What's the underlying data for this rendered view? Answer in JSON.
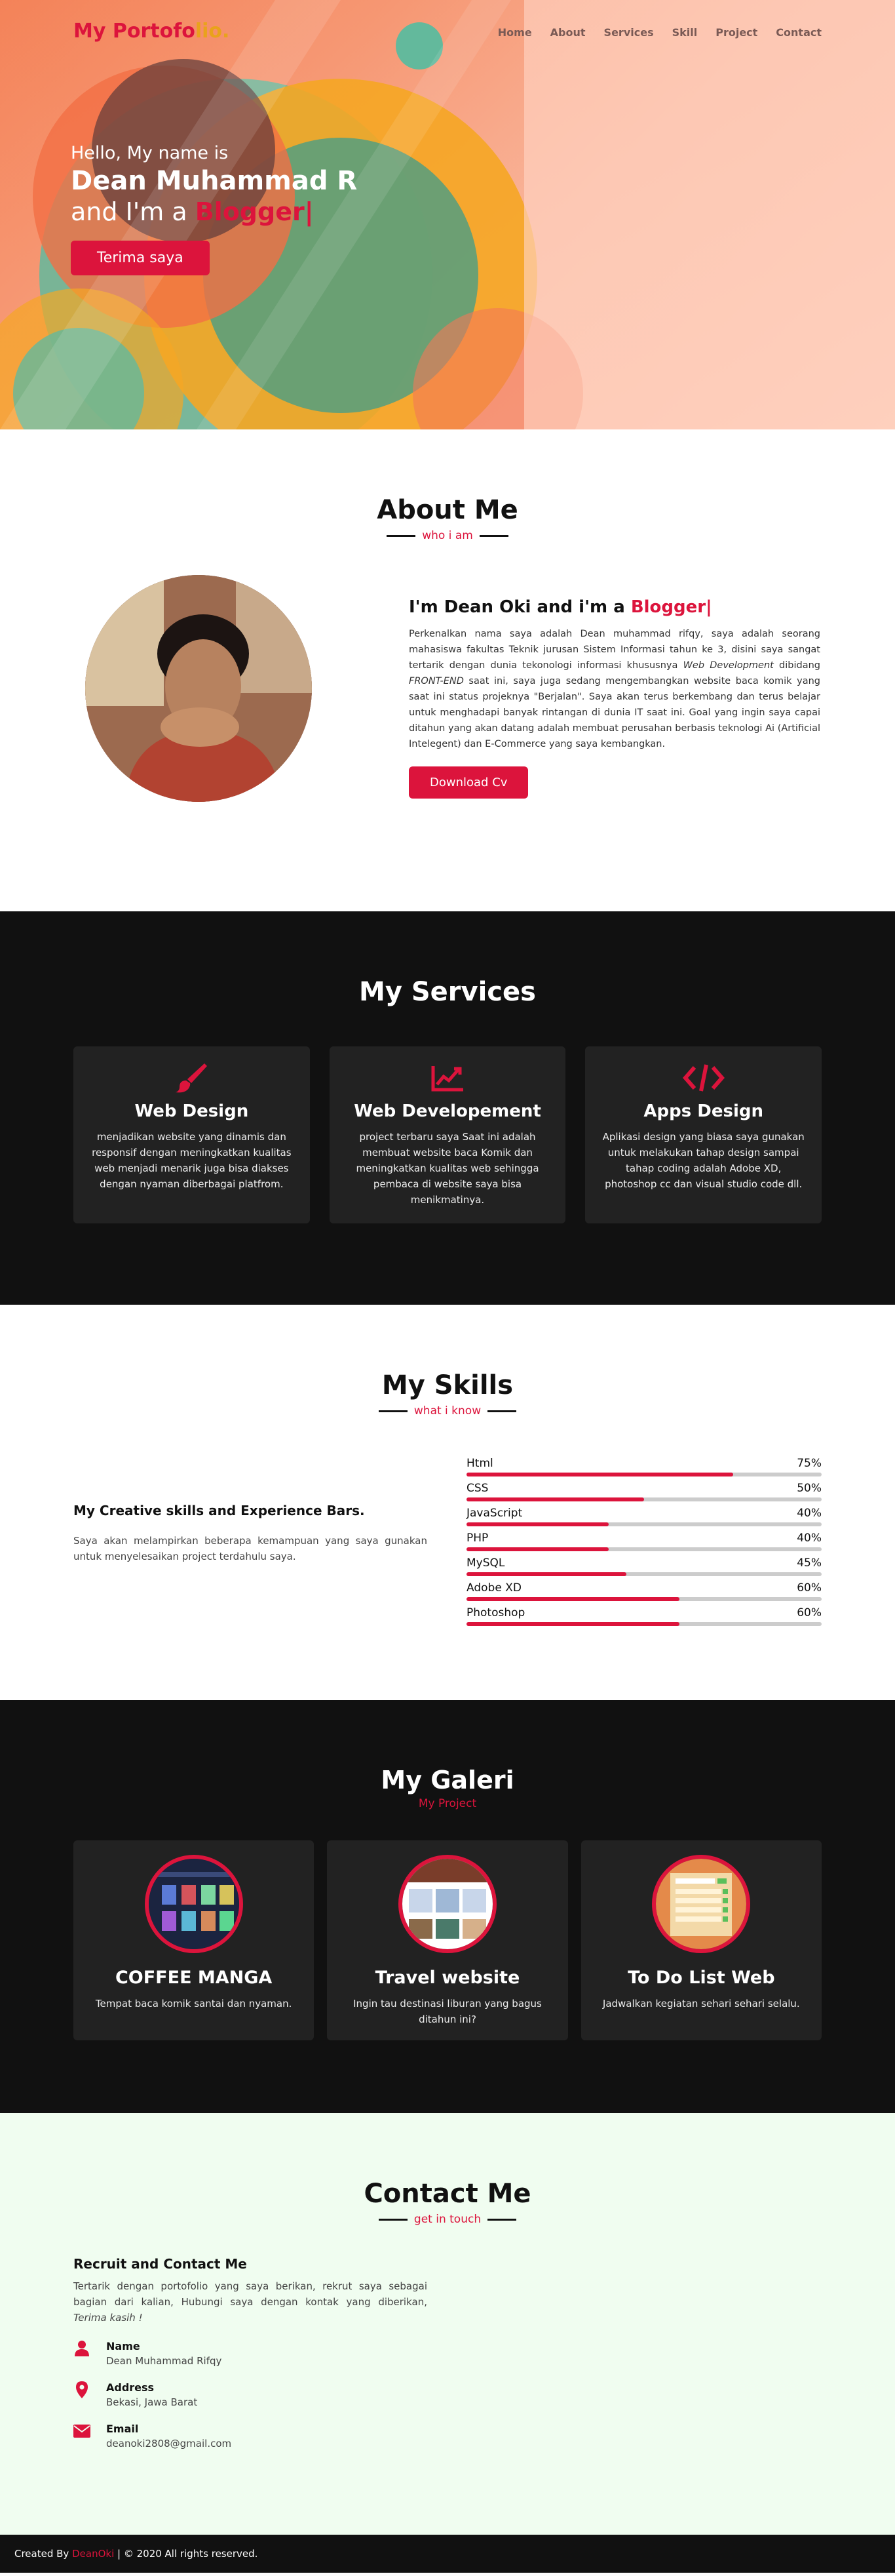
{
  "nav": {
    "brand_main": "My Portofo",
    "brand_highlight": "lio.",
    "items": [
      "Home",
      "About",
      "Services",
      "Skill",
      "Project",
      "Contact"
    ]
  },
  "hero": {
    "greeting": "Hello, My name is",
    "name": "Dean Muhammad R",
    "role_prefix": "and I'm a",
    "role": "Blogger|",
    "button": "Terima saya"
  },
  "about": {
    "title": "About Me",
    "subtitle": "who i am",
    "heading_prefix": "I'm Dean Oki and i'm a",
    "heading_role": "Blogger|",
    "text_1": "Perkenalkan nama saya adalah Dean muhammad rifqy, saya adalah seorang mahasiswa fakultas Teknik jurusan Sistem Informasi tahun ke 3, disini saya sangat tertarik dengan dunia tekonologi informasi khususnya ",
    "text_em1": "Web Development",
    "text_2": " dibidang ",
    "text_em2": "FRONT-END",
    "text_3": " saat ini, saya juga sedang mengembangkan website baca komik yang saat ini status projeknya \"Berjalan\". Saya akan terus berkembang dan terus belajar untuk menghadapi banyak rintangan di dunia IT saat ini. Goal yang ingin saya capai ditahun yang akan datang adalah membuat perusahan berbasis teknologi Ai (Artificial Intelegent) dan E-Commerce yang saya kembangkan.",
    "button": "Download Cv"
  },
  "services": {
    "title": "My Services",
    "items": [
      {
        "icon": "paintbrush-icon",
        "title": "Web Design",
        "text": "menjadikan website yang dinamis dan responsif dengan meningkatkan kualitas web menjadi menarik juga bisa diakses dengan nyaman diberbagai platfrom."
      },
      {
        "icon": "chart-line-icon",
        "title": "Web Developement",
        "text": "project terbaru saya Saat ini adalah membuat website baca Komik dan meningkatkan kualitas web sehingga pembaca di website saya bisa menikmatinya."
      },
      {
        "icon": "code-icon",
        "title": "Apps Design",
        "text": "Aplikasi design yang biasa saya gunakan untuk melakukan tahap design sampai tahap coding adalah Adobe XD, photoshop cc dan visual studio code dll."
      }
    ]
  },
  "skills": {
    "title": "My Skills",
    "subtitle": "what i know",
    "heading": "My Creative skills and Experience Bars.",
    "text": "Saya akan melampirkan beberapa kemampuan yang saya gunakan untuk menyelesaikan project terdahulu saya.",
    "items": [
      {
        "name": "Html",
        "label": "75%",
        "value": 0.75
      },
      {
        "name": "CSS",
        "label": "50%",
        "value": 0.5
      },
      {
        "name": "JavaScript",
        "label": "40%",
        "value": 0.4
      },
      {
        "name": "PHP",
        "label": "40%",
        "value": 0.4
      },
      {
        "name": "MySQL",
        "label": "45%",
        "value": 0.45
      },
      {
        "name": "Adobe XD",
        "label": "60%",
        "value": 0.6
      },
      {
        "name": "Photoshop",
        "label": "60%",
        "value": 0.6
      }
    ]
  },
  "gallery": {
    "title": "My Galeri",
    "subtitle": "My Project",
    "items": [
      {
        "title": "COFFEE MANGA",
        "text": "Tempat baca komik santai dan nyaman."
      },
      {
        "title": "Travel website",
        "text": "Ingin tau destinasi liburan yang bagus ditahun ini?"
      },
      {
        "title": "To Do List Web",
        "text": "Jadwalkan kegiatan sehari sehari selalu."
      }
    ]
  },
  "contact": {
    "title": "Contact Me",
    "subtitle": "get in touch",
    "heading": "Recruit and Contact Me",
    "intro": "Tertarik dengan portofolio yang saya berikan, rekrut saya sebagai bagian dari kalian, Hubungi saya dengan kontak yang diberikan, ",
    "intro_em": "Terima kasih !",
    "name_label": "Name",
    "name_value": "Dean Muhammad Rifqy",
    "address_label": "Address",
    "address_value": "Bekasi, Jawa Barat",
    "email_label": "Email",
    "email_value": "deanoki2808@gmail.com"
  },
  "footer": {
    "prefix": "Created By",
    "name": "DeanOki",
    "suffix": "| © 2020 All rights reserved."
  },
  "colors": {
    "accent": "#dc143c",
    "brand_highlight": "#e9a21c",
    "dark": "#111111",
    "card": "#222222",
    "contact_bg": "#f0fdf0"
  }
}
